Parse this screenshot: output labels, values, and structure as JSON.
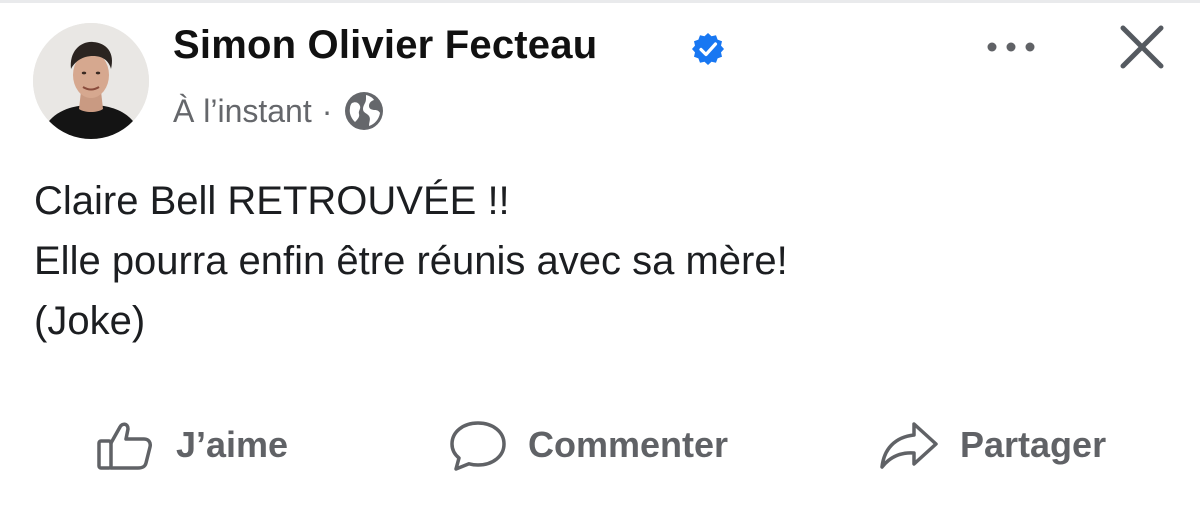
{
  "post": {
    "author": {
      "name": "Simon Olivier Fecteau",
      "verified_icon": "verified-badge-icon",
      "avatar": "profile-photo"
    },
    "meta": {
      "time": "À l’instant",
      "separator": "·",
      "audience_icon": "globe-icon"
    },
    "header_actions": {
      "more_icon": "more-options-icon",
      "close_icon": "close-icon"
    },
    "text_lines": [
      "Claire Bell RETROUVÉE !!",
      "Elle pourra enfin être réunis avec sa mère!",
      "(Joke)"
    ],
    "actions": [
      {
        "label": "J’aime",
        "icon": "thumbs-up-icon"
      },
      {
        "label": "Commenter",
        "icon": "comment-icon"
      },
      {
        "label": "Partager",
        "icon": "share-icon"
      }
    ]
  },
  "colors": {
    "verified_blue": "#1877f2",
    "meta_gray": "#65676b",
    "action_gray": "#606266",
    "text": "#1c1e21"
  }
}
